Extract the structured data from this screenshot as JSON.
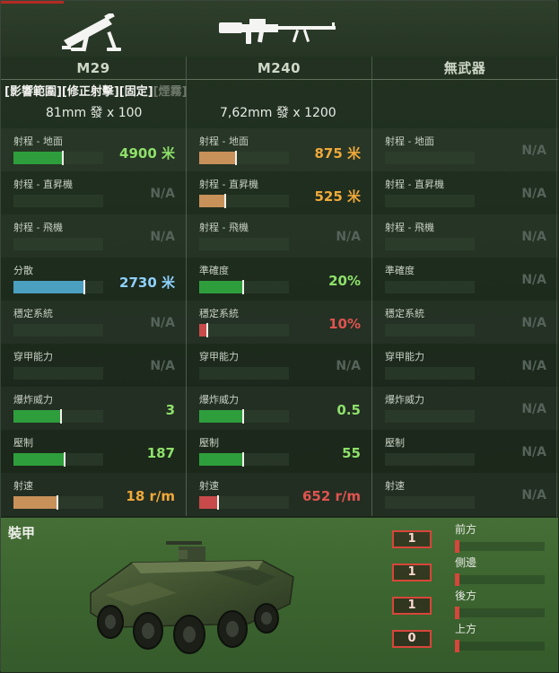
{
  "colors": {
    "green": "#2e9e3c",
    "orange": "#c8915a",
    "blue": "#4b9fc1",
    "red": "#c84a4a",
    "text_green": "#8ee06a",
    "text_orange": "#f0a93a",
    "text_red": "#e0534f",
    "text_blue": "#8fd1ff"
  },
  "weapons": [
    {
      "icon": "mortar-icon",
      "name": "M29",
      "ammo": "81mm 發 x 100"
    },
    {
      "icon": "machine-gun-icon",
      "name": "M240",
      "ammo": "7,62mm 發 x 1200"
    },
    {
      "icon": "",
      "name": "無武器",
      "ammo": ""
    }
  ],
  "modes": {
    "active": "[影響範圍][修正射擊][固定]",
    "inactive": "[煙霧]"
  },
  "stats": [
    {
      "label": "射程 - 地面",
      "cells": [
        {
          "value": "4900 米",
          "fill": 0.56,
          "color": "green",
          "text": "text_green"
        },
        {
          "value": "875 米",
          "fill": 0.42,
          "color": "orange",
          "text": "text_orange"
        },
        {
          "value": "N/A"
        }
      ]
    },
    {
      "label": "射程 - 直昇機",
      "cells": [
        {
          "value": "N/A"
        },
        {
          "value": "525 米",
          "fill": 0.3,
          "color": "orange",
          "text": "text_orange"
        },
        {
          "value": "N/A"
        }
      ]
    },
    {
      "label": "射程 - 飛機",
      "cells": [
        {
          "value": "N/A"
        },
        {
          "value": "N/A"
        },
        {
          "value": "N/A"
        }
      ]
    },
    {
      "labels": [
        "分散",
        "準確度",
        "準確度"
      ],
      "cells": [
        {
          "value": "2730 米",
          "fill": 0.8,
          "color": "blue",
          "text": "text_blue"
        },
        {
          "value": "20%",
          "fill": 0.5,
          "color": "green",
          "text": "text_green"
        },
        {
          "value": "N/A"
        }
      ]
    },
    {
      "label": "穩定系統",
      "cells": [
        {
          "value": "N/A"
        },
        {
          "value": "10%",
          "fill": 0.1,
          "color": "red",
          "text": "text_red"
        },
        {
          "value": "N/A"
        }
      ]
    },
    {
      "label": "穿甲能力",
      "cells": [
        {
          "value": "N/A"
        },
        {
          "value": "N/A"
        },
        {
          "value": "N/A"
        }
      ]
    },
    {
      "label": "爆炸威力",
      "cells": [
        {
          "value": "3",
          "fill": 0.54,
          "color": "green",
          "text": "text_green"
        },
        {
          "value": "0.5",
          "fill": 0.5,
          "color": "green",
          "text": "text_green"
        },
        {
          "value": "N/A"
        }
      ]
    },
    {
      "label": "壓制",
      "cells": [
        {
          "value": "187",
          "fill": 0.58,
          "color": "green",
          "text": "text_green"
        },
        {
          "value": "55",
          "fill": 0.5,
          "color": "green",
          "text": "text_green"
        },
        {
          "value": "N/A"
        }
      ]
    },
    {
      "label": "射速",
      "cells": [
        {
          "value": "18 r/m",
          "fill": 0.5,
          "color": "orange",
          "text": "text_orange"
        },
        {
          "value": "652 r/m",
          "fill": 0.22,
          "color": "red",
          "text": "text_red"
        },
        {
          "value": "N/A"
        }
      ]
    }
  ],
  "armor": {
    "title": "裝甲",
    "items": [
      {
        "label": "前方",
        "value": "1"
      },
      {
        "label": "側邊",
        "value": "1"
      },
      {
        "label": "後方",
        "value": "1"
      },
      {
        "label": "上方",
        "value": "0"
      }
    ]
  }
}
